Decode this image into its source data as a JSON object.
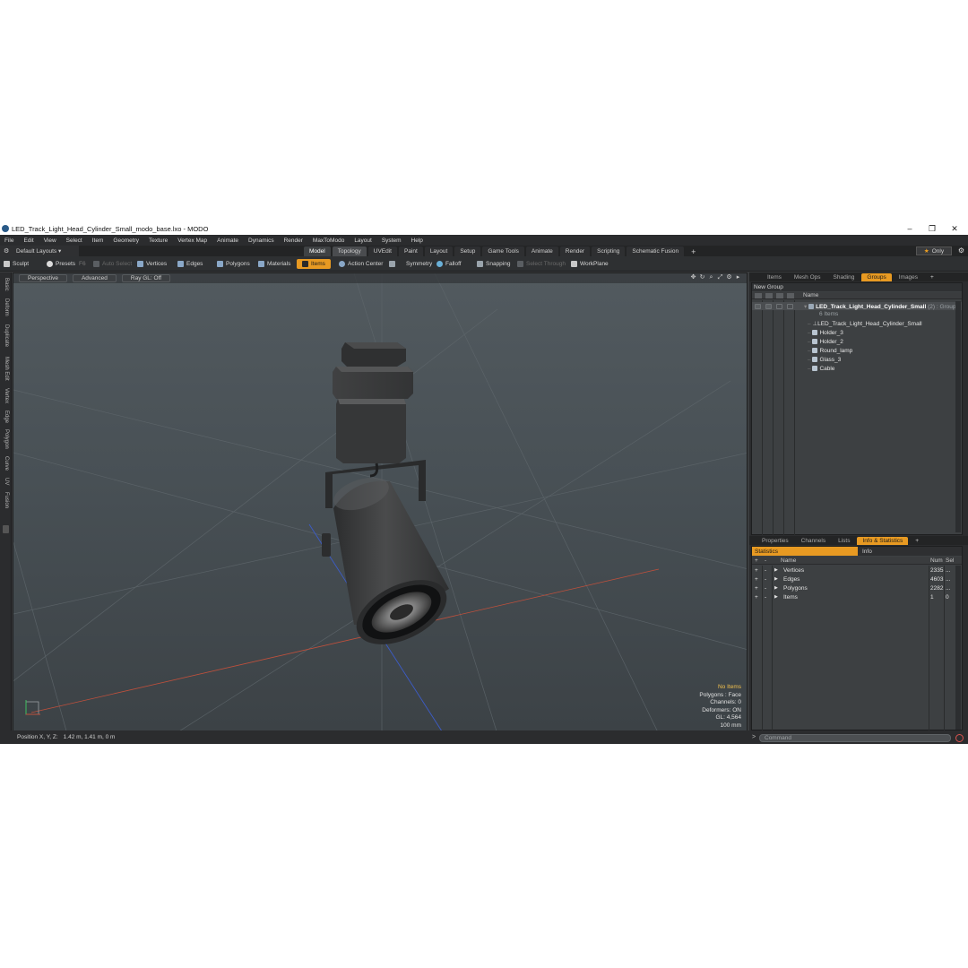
{
  "window": {
    "title": "LED_Track_Light_Head_Cylinder_Small_modo_base.lxo - MODO",
    "controls": [
      "–",
      "❐",
      "✕"
    ]
  },
  "menu": [
    "File",
    "Edit",
    "View",
    "Select",
    "Item",
    "Geometry",
    "Texture",
    "Vertex Map",
    "Animate",
    "Dynamics",
    "Render",
    "MaxToModo",
    "Layout",
    "System",
    "Help"
  ],
  "layout_bar": {
    "default_layouts": "Default Layouts ▾",
    "tabs": [
      "Model",
      "Topology",
      "UVEdit",
      "Paint",
      "Layout",
      "Setup",
      "Game Tools",
      "Animate",
      "Render",
      "Scripting",
      "Schematic Fusion"
    ],
    "active_tab": "Model",
    "add": "+",
    "only": "Only"
  },
  "toolbar": {
    "sculpt": "Sculpt",
    "presets": "Presets",
    "presets_key": "F6",
    "auto_select": "Auto Select",
    "vertices": "Vertices",
    "edges": "Edges",
    "polygons": "Polygons",
    "materials": "Materials",
    "items": "Items",
    "action_center": "Action Center",
    "symmetry": "Symmetry",
    "falloff": "Falloff",
    "snapping": "Snapping",
    "select_through": "Select Through",
    "workplane": "WorkPlane"
  },
  "left_strip": [
    "Basic",
    "Deform",
    "Duplicate",
    "Mesh Edit",
    "Vertex",
    "Edge",
    "Polygon",
    "Curve",
    "UV",
    "Fusion"
  ],
  "viewport": {
    "perspective": "Perspective",
    "advanced": "Advanced",
    "ray_gl": "Ray GL: Off",
    "info": {
      "no_items": "No Items",
      "polygons": "Polygons : Face",
      "channels": "Channels: 0",
      "deformers": "Deformers: ON",
      "gl": "GL: 4,564",
      "scale": "100 mm"
    }
  },
  "statusbar": {
    "label": "Position X, Y, Z:",
    "value": "1.42 m, 1.41 m, 0 m"
  },
  "top_panel": {
    "tabs": [
      "Items",
      "Mesh Ops",
      "Shading",
      "Groups",
      "Images"
    ],
    "active_tab": "Groups",
    "new_group": "New Group",
    "name_col": "Name",
    "group": {
      "name": "LED_Track_Light_Head_Cylinder_Small",
      "count": "(2)",
      "type": ": Group",
      "items_count": "6 Items"
    },
    "children": [
      "LED_Track_Light_Head_Cylinder_Small",
      "Holder_3",
      "Holder_2",
      "Round_lamp",
      "Glass_3",
      "Cable"
    ]
  },
  "bottom_panel": {
    "tabs": [
      "Properties",
      "Channels",
      "Lists",
      "Info & Statistics"
    ],
    "active_tab": "Info & Statistics",
    "subtabs": [
      "Statistics",
      "Info"
    ],
    "columns": {
      "name": "Name",
      "num": "Num",
      "sel": "Sel"
    },
    "rows": [
      {
        "name": "Vertices",
        "num": "2335",
        "sel": "..."
      },
      {
        "name": "Edges",
        "num": "4603",
        "sel": "..."
      },
      {
        "name": "Polygons",
        "num": "2282",
        "sel": "..."
      },
      {
        "name": "Items",
        "num": "1",
        "sel": "0"
      }
    ]
  },
  "command": {
    "prompt": ">",
    "placeholder": "Command"
  },
  "colors": {
    "accent": "#e89a22",
    "viewport_top": "#525a5f",
    "viewport_bottom": "#3c4246",
    "panel": "#3d4042",
    "x_axis": "#c0503c",
    "z_axis": "#3c5cc8",
    "model": "#3a3b3c"
  }
}
